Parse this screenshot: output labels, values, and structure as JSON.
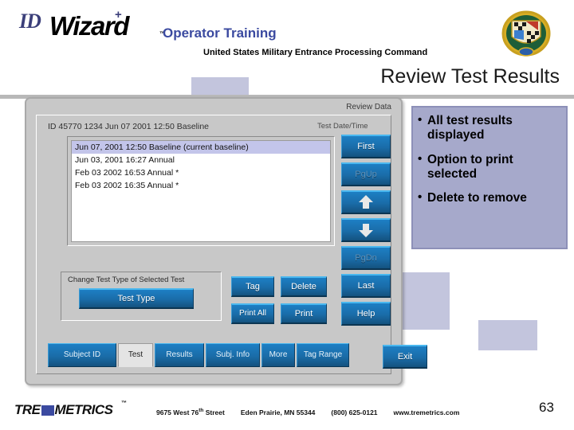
{
  "header": {
    "logo_id": "ID",
    "logo_wizard": "Wizard",
    "logo_plus": "+",
    "logo_tm": "™",
    "title": "Operator Training",
    "subtitle": "United States Military Entrance Processing Command",
    "page_title": "Review Test Results",
    "crest_name": "military-crest-icon"
  },
  "callout": {
    "bullets": [
      "All test results displayed",
      "Option to print selected",
      "Delete to remove"
    ]
  },
  "app": {
    "window_title": "Review Data",
    "record_id": "ID  45770 1234  Jun 07  2001  12:50  Baseline",
    "column_header": "Test Date/Time",
    "list": [
      {
        "text": "Jun 07, 2001 12:50  Baseline (current baseline)",
        "selected": true
      },
      {
        "text": "Jun 03, 2001 16:27  Annual",
        "selected": false
      },
      {
        "text": "Feb 03  2002 16:53  Annual *",
        "selected": false
      },
      {
        "text": "Feb 03  2002 16:35  Annual *",
        "selected": false
      }
    ],
    "nav_buttons": [
      {
        "label": "First",
        "state": "enabled",
        "icon": ""
      },
      {
        "label": "PgUp",
        "state": "disabled",
        "icon": ""
      },
      {
        "label": "",
        "state": "enabled",
        "icon": "arrow-up-icon"
      },
      {
        "label": "",
        "state": "enabled",
        "icon": "arrow-down-icon"
      },
      {
        "label": "PgDn",
        "state": "disabled",
        "icon": ""
      },
      {
        "label": "Last",
        "state": "enabled",
        "icon": ""
      },
      {
        "label": "Help",
        "state": "enabled",
        "icon": ""
      }
    ],
    "group_label": "Change Test Type of Selected Test",
    "test_type_button": "Test Type",
    "tag_button": "Tag",
    "delete_button": "Delete",
    "print_all_button": "Print All",
    "print_button": "Print",
    "tabs": [
      {
        "label": "Subject ID",
        "active": false
      },
      {
        "label": "Test",
        "active": true
      },
      {
        "label": "Results",
        "active": false
      },
      {
        "label": "Subj. Info",
        "active": false
      },
      {
        "label": "More",
        "active": false
      },
      {
        "label": "Tag Range",
        "active": false
      }
    ],
    "exit_button": "Exit"
  },
  "footer": {
    "company": "TRE",
    "company2": "METRICS",
    "tm": "™",
    "address": "9675 West 76",
    "address_sup": "th",
    "address2": " Street",
    "city": "Eden Prairie, MN 55344",
    "phone": "(800) 625-0121",
    "web": "www.tremetrics.com",
    "page_number": "63"
  },
  "colors": {
    "title_blue": "#3b4aa0",
    "button_blue": "#1a6ca8",
    "callout_bg": "#a6a9cb",
    "panel_gray": "#c8c8c8",
    "selection": "#c3c5ea"
  }
}
